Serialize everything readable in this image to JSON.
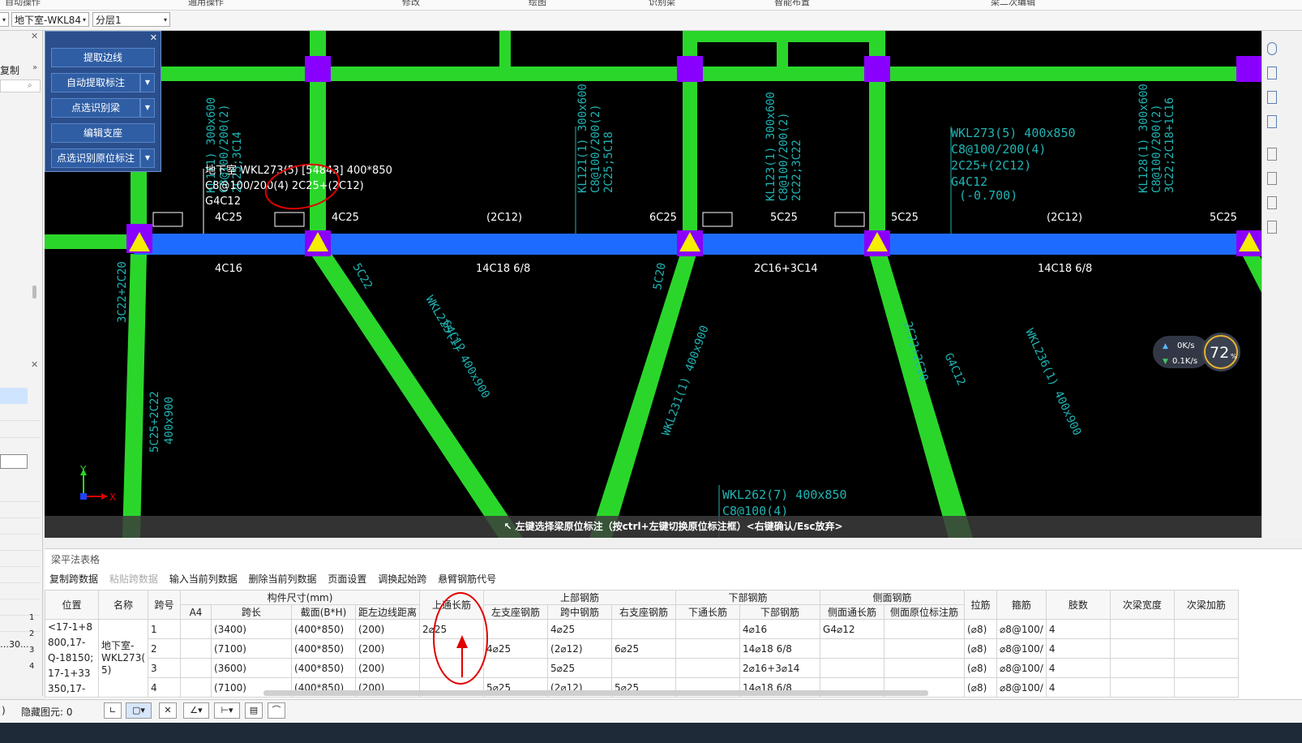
{
  "menu": [
    "自动操作",
    "通用操作",
    "修改",
    "绘图",
    "识别梁",
    "智能布置",
    "梁二次编辑"
  ],
  "toolbar": {
    "combo1_arrow": "▾",
    "combo2": "地下室-WKL84",
    "combo3": "分层1"
  },
  "left_panel": {
    "copy_label": "复制",
    "tail_text": "…30...",
    "row_nums": [
      "1",
      "2",
      "3",
      "4"
    ]
  },
  "float_panel": {
    "buttons": [
      "提取边线",
      "自动提取标注",
      "点选识别梁",
      "编辑支座",
      "点选识别原位标注"
    ]
  },
  "canvas": {
    "selected_beam_lines": [
      "地下室 WKL273(5) [54843] 400*850",
      "C8@100/200(4) 2C25+(2C12)",
      "G4C12"
    ],
    "top_labels": [
      "4C25",
      "4C25",
      "(2C12)",
      "6C25",
      "5C25",
      "5C25",
      "(2C12)",
      "5C25"
    ],
    "bottom_labels": [
      "4C16",
      "14C18 6/8",
      "2C16+3C14",
      "14C18 6/8"
    ],
    "wkl273_right": [
      "WKL273(5) 400x850",
      "C8@100/200(4)",
      "2C25+(2C12)",
      "G4C12",
      "(-0.700)"
    ],
    "wkl262": [
      "WKL262(7) 400x850",
      "C8@100(4)"
    ],
    "axis_x": "X",
    "axis_y": "Y",
    "status_message": "左键选择梁原位标注（按ctrl+左键切换原位标注框）<右键确认/Esc放弃>"
  },
  "net_widget": {
    "up": "0K/s",
    "down": "0.1K/s",
    "percent": "72",
    "percent_unit": "%"
  },
  "table": {
    "title": "梁平法表格",
    "tools": [
      "复制跨数据",
      "粘贴跨数据",
      "输入当前列数据",
      "删除当前列数据",
      "页面设置",
      "调换起始跨",
      "悬臂钢筋代号"
    ],
    "group_headers": {
      "size": "构件尺寸(mm)",
      "top_rebar": "上部钢筋",
      "bottom_rebar": "下部钢筋",
      "side_rebar": "侧面钢筋"
    },
    "headers": {
      "pos": "位置",
      "name": "名称",
      "span": "跨号",
      "a4": "A4",
      "span_len": "跨长",
      "section": "截面(B*H)",
      "dist": "距左边线距离",
      "top_through": "上通长筋",
      "left_seat": "左支座钢筋",
      "mid": "跨中钢筋",
      "right_seat": "右支座钢筋",
      "bot_through": "下通长筋",
      "bot": "下部钢筋",
      "side_through": "侧面通长筋",
      "side_orig": "侧面原位标注筋",
      "tie": "拉筋",
      "stirrup": "箍筋",
      "legs": "肢数",
      "sec_width": "次梁宽度",
      "sec_add": "次梁加筋"
    },
    "position_text": [
      "<17-1+8",
      "800,17-",
      "Q-18150;",
      "17-1+33",
      "350,17-"
    ],
    "name_text": [
      "地下室-",
      "WKL273(",
      "5)"
    ],
    "rows": [
      {
        "span": "1",
        "span_len": "(3400)",
        "section": "(400*850)",
        "dist": "(200)",
        "top_through": "2⌀25",
        "left_seat": "",
        "mid": "4⌀25",
        "right_seat": "",
        "bot": "4⌀16",
        "side_through": "G4⌀12",
        "tie": "(⌀8)",
        "stirrup": "⌀8@100/",
        "legs": "4"
      },
      {
        "span": "2",
        "span_len": "(7100)",
        "section": "(400*850)",
        "dist": "(200)",
        "top_through": "",
        "left_seat": "4⌀25",
        "mid": "(2⌀12)",
        "right_seat": "6⌀25",
        "bot": "14⌀18 6/8",
        "side_through": "",
        "tie": "(⌀8)",
        "stirrup": "⌀8@100/",
        "legs": "4"
      },
      {
        "span": "3",
        "span_len": "(3600)",
        "section": "(400*850)",
        "dist": "(200)",
        "top_through": "",
        "left_seat": "",
        "mid": "5⌀25",
        "right_seat": "",
        "bot": "2⌀16+3⌀14",
        "side_through": "",
        "tie": "(⌀8)",
        "stirrup": "⌀8@100/",
        "legs": "4"
      },
      {
        "span": "4",
        "span_len": "(7100)",
        "section": "(400*850)",
        "dist": "(200)",
        "top_through": "",
        "left_seat": "5⌀25",
        "mid": "(2⌀12)",
        "right_seat": "5⌀25",
        "bot": "14⌀18 6/8",
        "side_through": "",
        "tie": "(⌀8)",
        "stirrup": "⌀8@100/",
        "legs": "4"
      }
    ]
  },
  "bottom_bar": {
    "hidden_label": "隐藏图元: 0",
    "paren": ")"
  },
  "colors": {
    "beam_green": "#2bd62b",
    "beam_selected": "#1e6cff",
    "column_purple": "#8a00ff",
    "support_yellow": "#f5ee00",
    "cad_text_cyan": "#21b3b3",
    "annotation_red": "#e00000"
  }
}
